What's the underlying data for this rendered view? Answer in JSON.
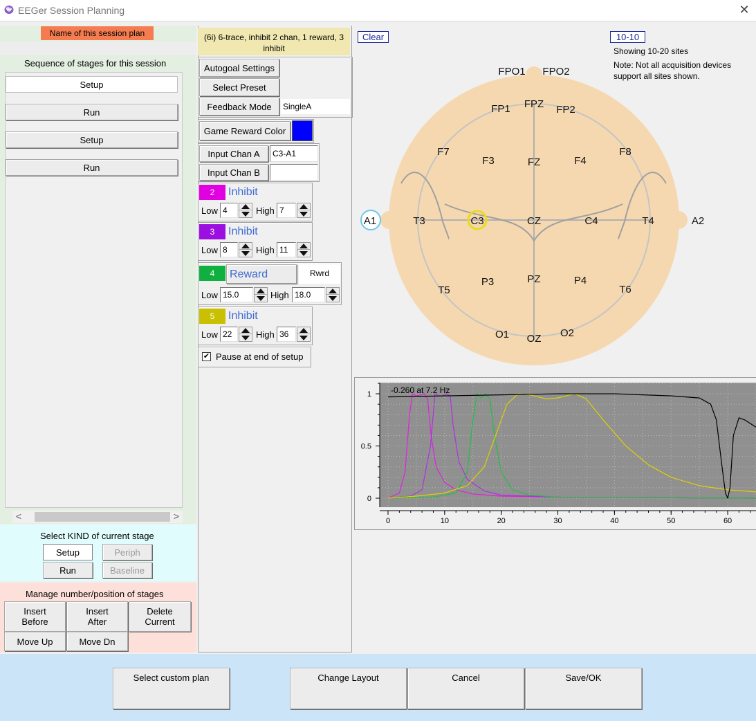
{
  "window": {
    "title": "EEGer Session Planning"
  },
  "left": {
    "plan_name_label": "Name of this session plan",
    "plan_name_value": "",
    "sequence_header": "Sequence of stages for this session",
    "stages": [
      "Setup",
      "Run",
      "Setup",
      "Run"
    ],
    "kind_header": "Select KIND of current stage",
    "kind_buttons": {
      "setup": "Setup",
      "periph": "Periph",
      "run": "Run",
      "baseline": "Baseline"
    },
    "manage_header": "Manage number/position of stages",
    "manage_buttons": {
      "insert_before": "Insert\nBefore",
      "insert_after": "Insert\nAfter",
      "delete_current": "Delete\nCurrent",
      "move_up": "Move Up",
      "move_dn": "Move Dn"
    }
  },
  "middle": {
    "preset_desc": "(6i) 6-trace, inhibit 2 chan, 1 reward, 3 inhibit",
    "autogoal": "Autogoal Settings",
    "select_preset": "Select Preset",
    "feedback_mode_label": "Feedback Mode",
    "feedback_mode_value": "SingleA",
    "game_reward_color_label": "Game Reward Color",
    "game_reward_color": "#0000ff",
    "input_a_label": "Input Chan A",
    "input_a_value": "C3-A1",
    "input_b_label": "Input Chan B",
    "input_b_value": "",
    "bands": [
      {
        "num": "2",
        "color": "#e000e0",
        "kind": "Inhibit",
        "low_label": "Low",
        "low": "4",
        "high_label": "High",
        "high": "7"
      },
      {
        "num": "3",
        "color": "#9b10e0",
        "kind": "Inhibit",
        "low_label": "Low",
        "low": "8",
        "high_label": "High",
        "high": "11"
      },
      {
        "num": "4",
        "color": "#10b040",
        "kind": "Reward",
        "extra": "Rwrd",
        "low_label": "Low",
        "low": "15.0",
        "high_label": "High",
        "high": "18.0"
      },
      {
        "num": "5",
        "color": "#c8c000",
        "kind": "Inhibit",
        "low_label": "Low",
        "low": "22",
        "high_label": "High",
        "high": "36"
      }
    ],
    "pause_label": "Pause at end of setup",
    "pause_checked": "✔"
  },
  "head": {
    "clear": "Clear",
    "mode": "10-10",
    "showing": "Showing 10-20 sites",
    "note_line1": "Note: Not all acquisition devices",
    "note_line2": "support all sites shown.",
    "head_color": "#f5d8b0",
    "selected_site": "C3",
    "reference_site": "A1",
    "sites": {
      "FPO1": "FPO1",
      "FPO2": "FPO2",
      "FP1": "FP1",
      "FPZ": "FPZ",
      "FP2": "FP2",
      "F7": "F7",
      "F3": "F3",
      "FZ": "FZ",
      "F4": "F4",
      "F8": "F8",
      "A1": "A1",
      "T3": "T3",
      "C3": "C3",
      "CZ": "CZ",
      "C4": "C4",
      "T4": "T4",
      "A2": "A2",
      "T5": "T5",
      "P3": "P3",
      "PZ": "PZ",
      "P4": "P4",
      "T6": "T6",
      "O1": "O1",
      "OZ": "OZ",
      "O2": "O2"
    }
  },
  "chart_data": {
    "type": "line",
    "readout": "-0.260 at  7.2 Hz",
    "xlim": [
      0,
      65
    ],
    "ylim": [
      0,
      1.1
    ],
    "xticks": [
      0,
      10,
      20,
      30,
      40,
      50,
      60
    ],
    "yticks": [
      0,
      0.5,
      1
    ],
    "background": "#909090",
    "series": [
      {
        "color": "#e020e0",
        "x": [
          0,
          2,
          3,
          3.8,
          4.3,
          5,
          5.8,
          6.4,
          7,
          7.6,
          8.5,
          10,
          12,
          15,
          20,
          30,
          65
        ],
        "y": [
          0,
          0.05,
          0.25,
          0.8,
          1.0,
          0.98,
          0.99,
          1.0,
          0.95,
          0.6,
          0.3,
          0.15,
          0.08,
          0.04,
          0.02,
          0.01,
          0
        ]
      },
      {
        "color": "#b030e0",
        "x": [
          0,
          4,
          6,
          7.5,
          8.3,
          9,
          9.6,
          10.3,
          11,
          11.5,
          12.5,
          14,
          17,
          20,
          30,
          65
        ],
        "y": [
          0,
          0.02,
          0.08,
          0.5,
          1.0,
          0.98,
          0.98,
          1.0,
          0.98,
          0.7,
          0.35,
          0.18,
          0.07,
          0.03,
          0.01,
          0
        ]
      },
      {
        "color": "#20c040",
        "x": [
          0,
          8,
          12,
          14,
          15,
          15.7,
          16.5,
          17.2,
          18,
          18.8,
          20,
          22,
          25,
          30,
          65
        ],
        "y": [
          0,
          0.01,
          0.05,
          0.25,
          0.75,
          1.0,
          0.96,
          1.0,
          0.95,
          0.6,
          0.25,
          0.08,
          0.03,
          0.01,
          0
        ]
      },
      {
        "color": "#e0d000",
        "x": [
          0,
          5,
          10,
          14,
          17,
          19,
          21,
          23,
          25,
          28,
          30,
          33,
          35,
          38,
          42,
          46,
          50,
          55,
          60,
          65
        ],
        "y": [
          0,
          0.02,
          0.05,
          0.12,
          0.3,
          0.6,
          0.9,
          1.0,
          0.99,
          0.95,
          0.96,
          1.0,
          0.95,
          0.75,
          0.5,
          0.32,
          0.2,
          0.12,
          0.08,
          0.06
        ]
      },
      {
        "color": "#000000",
        "x": [
          0,
          10,
          20,
          30,
          40,
          50,
          55,
          57,
          58,
          59,
          59.6,
          60,
          60.4,
          61,
          62,
          63,
          65
        ],
        "y": [
          0.97,
          0.98,
          0.99,
          1.0,
          1.0,
          0.98,
          0.96,
          0.9,
          0.75,
          0.3,
          0.05,
          0,
          0.1,
          0.6,
          0.77,
          0.75,
          0.68
        ]
      }
    ]
  },
  "bottom": {
    "select_custom": "Select custom plan",
    "change_layout": "Change Layout",
    "cancel": "Cancel",
    "save_ok": "Save/OK"
  }
}
